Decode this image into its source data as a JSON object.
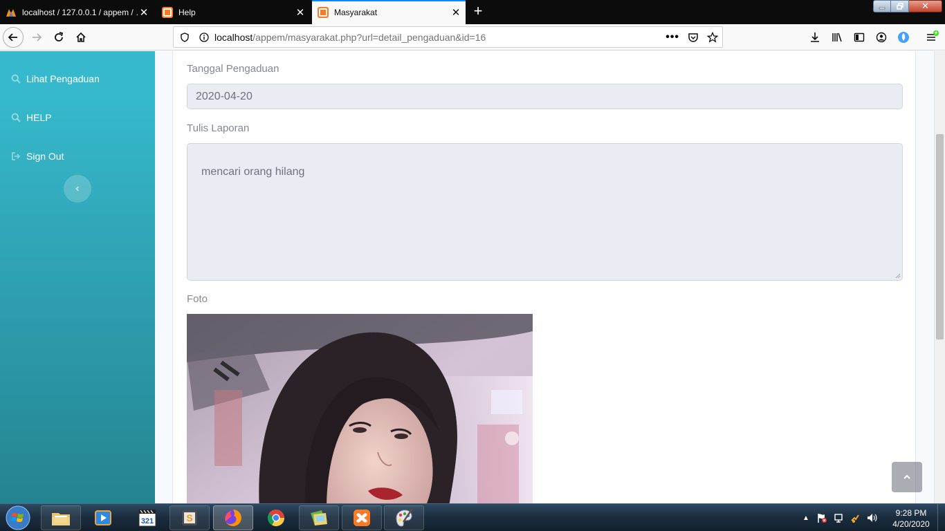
{
  "browser": {
    "tabs": [
      {
        "title": "localhost / 127.0.0.1 / appem / …",
        "favicon": "phpmyadmin-icon",
        "active": false
      },
      {
        "title": "Help",
        "favicon": "xampp-icon",
        "active": false
      },
      {
        "title": "Masyarakat",
        "favicon": "xampp-icon",
        "active": true
      }
    ],
    "url_host": "localhost",
    "url_path": "/appem/masyarakat.php?url=detail_pengaduan&id=16",
    "accent": "#0a84ff"
  },
  "sidebar": {
    "items": [
      {
        "label": "Lihat Pengaduan",
        "icon": "search-icon"
      },
      {
        "label": "HELP",
        "icon": "search-icon"
      },
      {
        "label": "Sign Out",
        "icon": "sign-out-icon"
      }
    ],
    "gradient_top": "#36b9cc",
    "gradient_bottom": "#258391"
  },
  "form": {
    "tanggal_label": "Tanggal Pengaduan",
    "tanggal_value": "2020-04-20",
    "laporan_label": "Tulis Laporan",
    "laporan_value": "mencari orang hilang",
    "foto_label": "Foto"
  },
  "taskbar": {
    "apps": [
      "windows-media-player-icon",
      "slideshow-321-icon",
      "sublime-text-icon",
      "firefox-icon",
      "chrome-icon",
      "folder-icon",
      "xampp-icon",
      "paint-icon"
    ],
    "clock_time": "9:28 PM",
    "clock_date": "4/20/2020"
  }
}
